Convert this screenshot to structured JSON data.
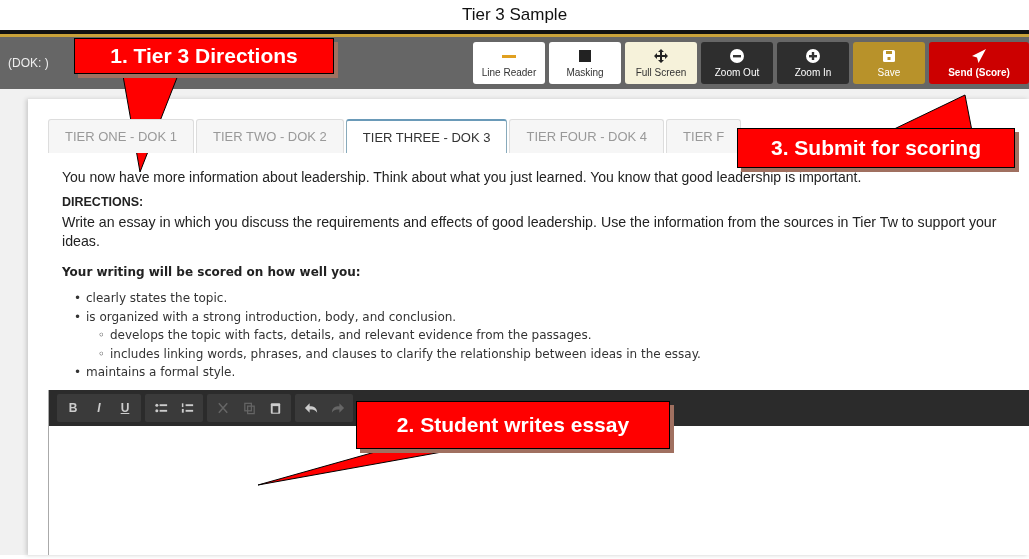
{
  "page_title": "Tier 3 Sample",
  "header": {
    "label": "(DOK: )",
    "tools": [
      {
        "kind": "line-reader",
        "label": "Line Reader"
      },
      {
        "kind": "masking",
        "label": "Masking"
      },
      {
        "kind": "full-screen",
        "label": "Full Screen"
      },
      {
        "kind": "zoom-out",
        "label": "Zoom Out"
      },
      {
        "kind": "zoom-in",
        "label": "Zoom In"
      },
      {
        "kind": "save",
        "label": "Save"
      },
      {
        "kind": "send",
        "label": "Send (Score)"
      }
    ]
  },
  "tabs": [
    {
      "label": "TIER ONE - DOK 1",
      "selected": false
    },
    {
      "label": "TIER TWO - DOK 2",
      "selected": false
    },
    {
      "label": "TIER THREE - DOK 3",
      "selected": true
    },
    {
      "label": "TIER FOUR - DOK 4",
      "selected": false
    },
    {
      "label": "TIER F",
      "selected": false
    }
  ],
  "intro": "You now have more information about leadership. Think about what you just learned. You know that good leadership is important.",
  "directions_heading": "DIRECTIONS:",
  "directions": "Write an essay in which you discuss the requirements and effects of good leadership. Use the information from the sources in Tier Tw to support your ideas.",
  "scoring_heading": "Your writing will be scored on how well you:",
  "criteria": [
    {
      "bullet": "•",
      "text": "clearly states the topic."
    },
    {
      "bullet": "•",
      "text": "is organized with a strong introduction, body, and conclusion.",
      "children": [
        {
          "bullet": "◦",
          "text": "develops the topic with facts, details, and relevant evidence from the passages."
        },
        {
          "bullet": "◦",
          "text": "includes linking words, phrases, and clauses to clarify the relationship between ideas in the essay."
        }
      ]
    },
    {
      "bullet": "•",
      "text": "maintains a formal style."
    }
  ],
  "editor_toolbar": [
    {
      "kind": "bold",
      "label": "B",
      "disabled": false
    },
    {
      "kind": "italic",
      "label": "I",
      "disabled": false
    },
    {
      "kind": "underline",
      "label": "U",
      "disabled": false
    },
    {
      "kind": "bullets",
      "disabled": false
    },
    {
      "kind": "numbers",
      "disabled": false
    },
    {
      "kind": "cut",
      "disabled": true
    },
    {
      "kind": "copy",
      "disabled": true
    },
    {
      "kind": "paste",
      "disabled": false
    },
    {
      "kind": "undo",
      "disabled": false
    },
    {
      "kind": "redo",
      "disabled": true
    }
  ],
  "callouts": [
    {
      "text": "1. Tier 3 Directions"
    },
    {
      "text": "2. Student writes essay"
    },
    {
      "text": "3. Submit for scoring"
    }
  ]
}
